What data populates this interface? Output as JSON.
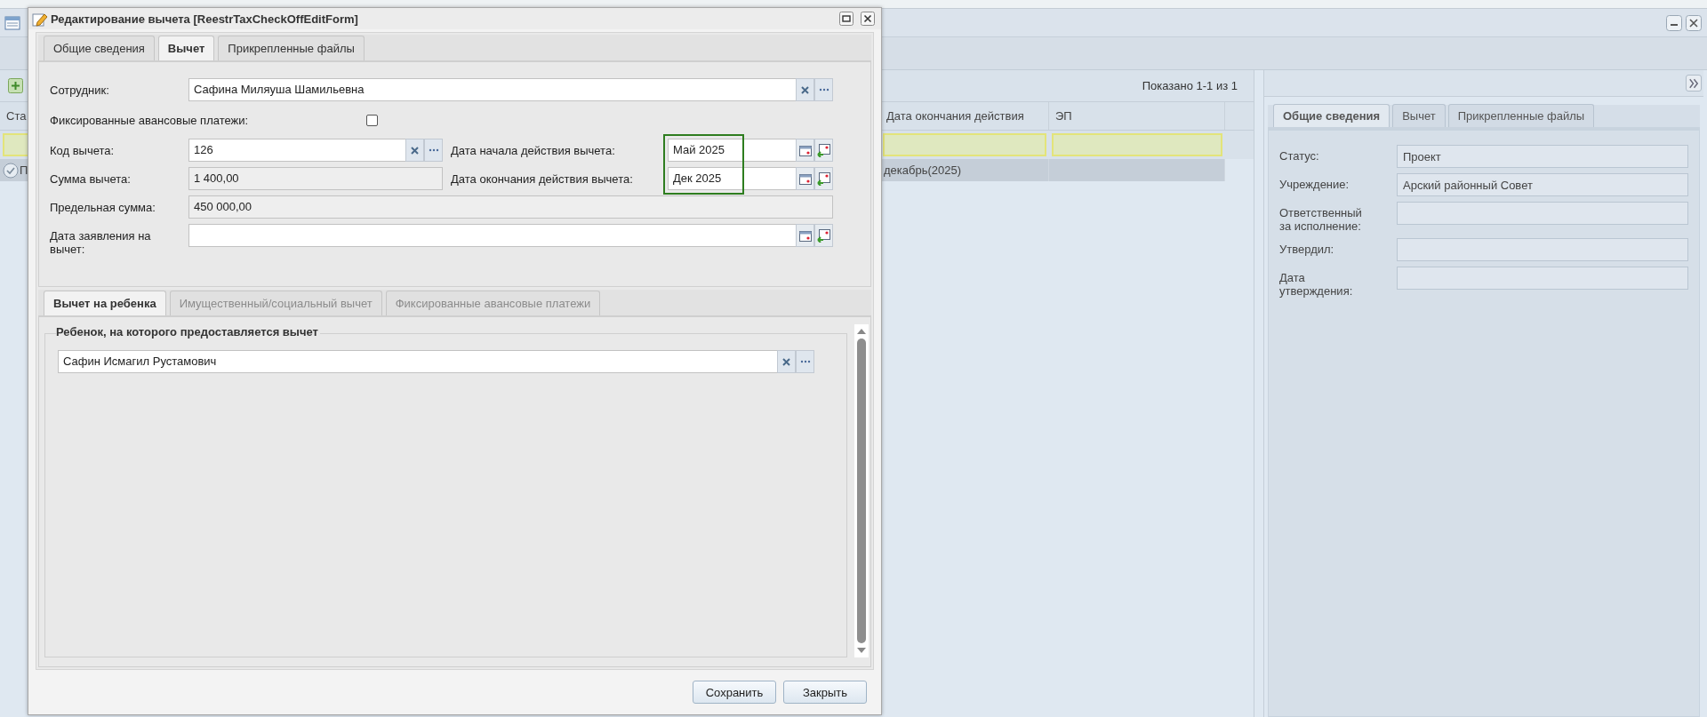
{
  "grid": {
    "paging": "Показано 1-1 из 1",
    "columns": [
      "Ста",
      "Дата окончания действия",
      "ЭП"
    ],
    "rows": [
      {
        "selected": true,
        "cells": [
          "П",
          "декабрь(2025)"
        ]
      }
    ]
  },
  "details": {
    "tabs": [
      {
        "label": "Общие сведения",
        "selected": true
      },
      {
        "label": "Вычет",
        "selected": false
      },
      {
        "label": "Прикрепленные файлы",
        "selected": false
      }
    ],
    "fields": [
      {
        "label": "Статус:",
        "value": "Проект"
      },
      {
        "label": "Учреждение:",
        "value": "Арский районный Совет"
      },
      {
        "label": "Ответственный за исполнение:"
      },
      {
        "label": "Утвердил:"
      },
      {
        "label": "Дата утверждения:"
      }
    ]
  },
  "dialog": {
    "title": "Редактирование вычета [ReestrTaxCheckOffEditForm]",
    "tabs": [
      {
        "label": "Общие сведения",
        "selected": false
      },
      {
        "label": "Вычет",
        "selected": true
      },
      {
        "label": "Прикрепленные файлы",
        "selected": false
      }
    ],
    "rows": [
      {
        "fields": [
          {
            "kind": "lookup",
            "label": "Сотрудник:",
            "value": "Сафина Миляуша Шамильевна"
          }
        ]
      },
      {
        "fields": [
          {
            "kind": "checkbox",
            "label": "Фиксированные авансовые платежи:",
            "checked": false
          }
        ]
      },
      {
        "fields": [
          {
            "kind": "lookup",
            "label": "Код вычета:",
            "value": "126"
          },
          {
            "kind": "date",
            "label": "Дата начала действия вычета:",
            "value": "Май 2025",
            "highlighted": true
          }
        ]
      },
      {
        "fields": [
          {
            "kind": "text",
            "label": "Сумма вычета:",
            "value": "1 400,00",
            "readonly": true
          },
          {
            "kind": "date",
            "label": "Дата окончания действия вычета:",
            "value": "Дек 2025",
            "highlighted": true
          }
        ]
      },
      {
        "fields": [
          {
            "kind": "text",
            "label": "Предельная сумма:",
            "value": "450 000,00",
            "readonly": true
          }
        ]
      },
      {
        "fields": [
          {
            "kind": "date",
            "label": "Дата заявления на вычет:"
          }
        ]
      }
    ],
    "subtabs": [
      {
        "label": "Вычет на ребенка",
        "selected": true,
        "disabled": false
      },
      {
        "label": "Имущественный/социальный вычет",
        "selected": false,
        "disabled": true
      },
      {
        "label": "Фиксированные авансовые платежи",
        "selected": false,
        "disabled": true
      }
    ],
    "child_group": {
      "legend": "Ребенок, на которого предоставляется вычет",
      "field": {
        "kind": "lookup",
        "value": "Сафин Исмагил Рустамович"
      }
    },
    "buttons": [
      "Сохранить",
      "Закрыть"
    ]
  }
}
